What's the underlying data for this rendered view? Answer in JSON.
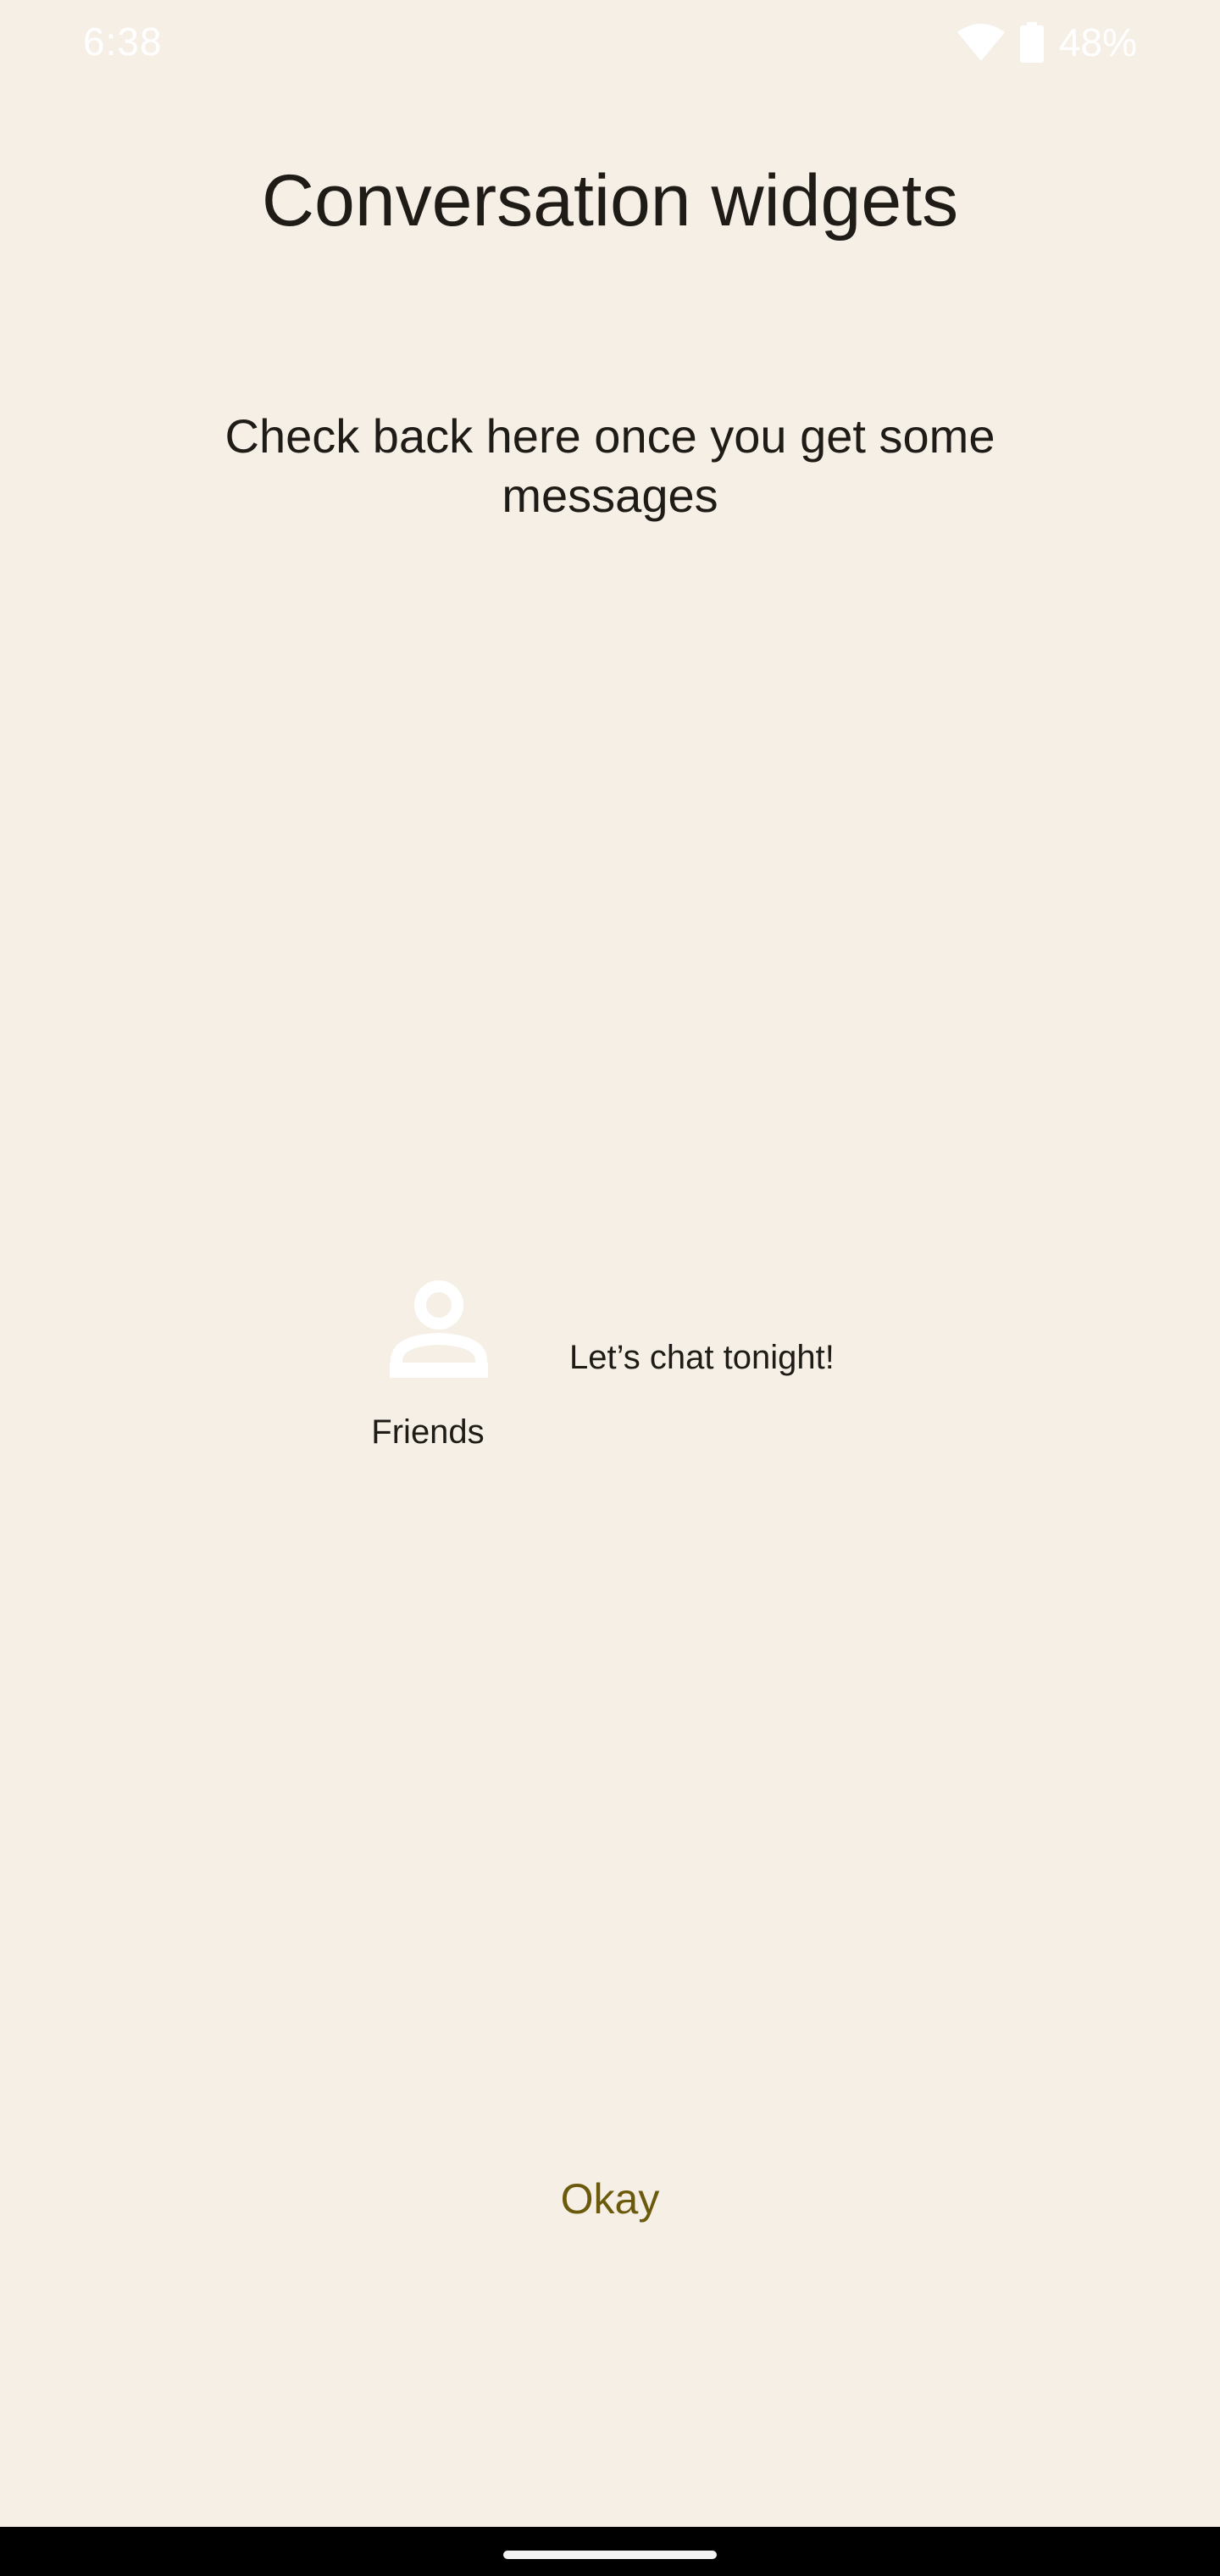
{
  "status_bar": {
    "time": "6:38",
    "battery_percent": "48%",
    "icons": [
      "wifi-icon",
      "battery-icon"
    ]
  },
  "page": {
    "title": "Conversation widgets",
    "empty_message": "Check back here once you get some messages"
  },
  "widget_preview": {
    "contact_name": "Friends",
    "message": "Let’s chat tonight!",
    "avatar_icon": "person-icon"
  },
  "actions": {
    "okay_label": "Okay"
  },
  "colors": {
    "background": "#f5efe6",
    "text_primary": "#1f1c17",
    "accent": "#6c5a0c",
    "status_icons": "#ffffff",
    "nav_bar": "#000000"
  }
}
